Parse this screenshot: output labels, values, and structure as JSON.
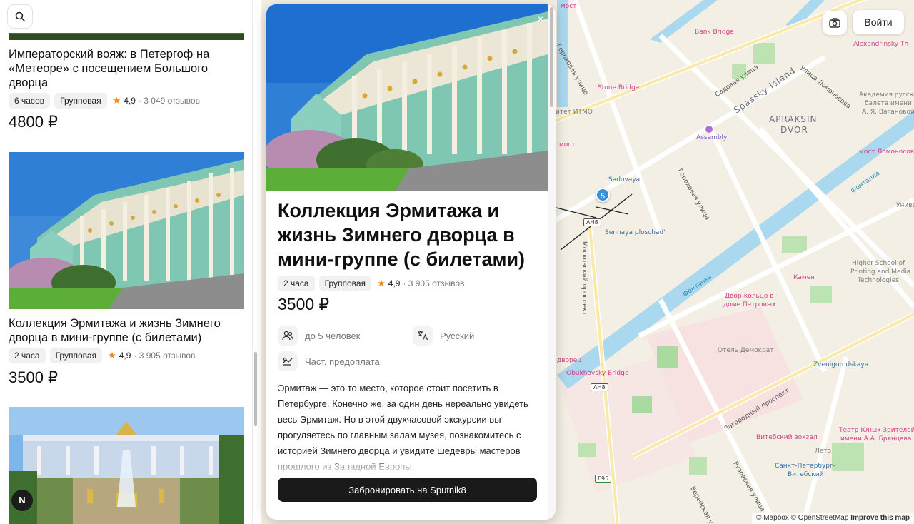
{
  "left_list": {
    "search_icon": "search-icon",
    "cards": [
      {
        "title": "Императорский вояж: в Петергоф на «Метеоре» с посещением Большого дворца",
        "duration": "6 часов",
        "type": "Групповая",
        "rating": "4,9",
        "reviews": "· 3 049 отзывов",
        "price": "4800 ₽"
      },
      {
        "title": "Коллекция Эрмитажа и жизнь Зимнего дворца в мини-группе (с билетами)",
        "duration": "2 часа",
        "type": "Групповая",
        "rating": "4,9",
        "reviews": "· 3 905 отзывов",
        "price": "3500 ₽"
      }
    ],
    "avatar_letter": "N"
  },
  "modal": {
    "close_glyph": "×",
    "title": "Коллекция Эрмитажа и жизнь Зимнего дворца в мини-группе (с билетами)",
    "duration": "2 часа",
    "type": "Групповая",
    "rating": "4,9",
    "reviews": "· 3 905 отзывов",
    "price": "3500 ₽",
    "features": {
      "group_size": "до 5 человек",
      "language": "Русский",
      "payment": "Част. предоплата"
    },
    "description": "Эрмитаж — это то место, которое стоит посетить в Петербурге. Конечно же, за один день нереально увидеть весь Эрмитаж. Но в этой двухчасовой экскурсии вы прогуляетесь по главным залам музея, познакомитесь с историей Зимнего дворца и увидите шедевры мастеров прошлого из Западной Европы.",
    "book_button": "Забронировать на Sputnik8"
  },
  "map": {
    "camera_icon": "camera-icon",
    "login_button": "Войти",
    "attribution": {
      "mapbox": "© Mapbox",
      "osm": "© OpenStreetMap",
      "improve": "Improve this map"
    },
    "metro_number": "5",
    "labels": {
      "most_top": "мост",
      "bank_bridge": "Bank Bridge",
      "alexandrinsky": "Alexandrinsky Th",
      "gorokhovaya_top": "Гороховая улица",
      "sadovaya_street": "Садовая улица",
      "spassky_island": "Spassky Island",
      "lomonosova_street": "улица Ломоносова",
      "stone_bridge": "Stone Bridge",
      "itmo": "итет ИТМО",
      "apraksin": "APRAKSIN",
      "dvor": "DVOR",
      "academy1": "Академия русского",
      "academy2": "балета имени",
      "academy3": "А. Я. Вагановой",
      "assembly": "Assembly",
      "most_left": "мост",
      "most_lomonosova": "мост Ломоносова",
      "sadovaya_metro": "Sadovaya",
      "gorokhovaya_mid": "Гороховая улица",
      "fontanka_top": "Фонтанка",
      "sennaya": "Sennaya ploschad'",
      "shield_ah8_top": "AH8",
      "moskovsky": "Московский проспект",
      "univer": "Униве",
      "hse1": "Higher School of",
      "hse2": "Printing and Media",
      "hse3": "Technologies",
      "kameya": "Камея",
      "fontanka_mid": "Фонтанка",
      "dvor_kolco1": "Двор-кольцо в",
      "dvor_kolco2": "доме Петровых",
      "hotel_demokrat": "Отель Демократ",
      "dvorec": "дворец",
      "obukhovsky": "Obukhovsky Bridge",
      "zvenigorodskaya": "Zvenigorodskaya",
      "shield_ah8_bottom": "AH8",
      "zagorodny": "Загородный проспект",
      "vitebsky_vokzal": "Витебский вокзал",
      "teatr1": "Театр Юных Зрителей",
      "teatr2": "имени А.А. Брянцева",
      "leto": "Лето",
      "spb_vitebsky1": "Санкт-Петербург-",
      "spb_vitebsky2": "Витебский",
      "ruzovskaya": "Рузовская улица",
      "vereyskaya": "Верейская улица",
      "shield_e95": "E95"
    }
  }
}
